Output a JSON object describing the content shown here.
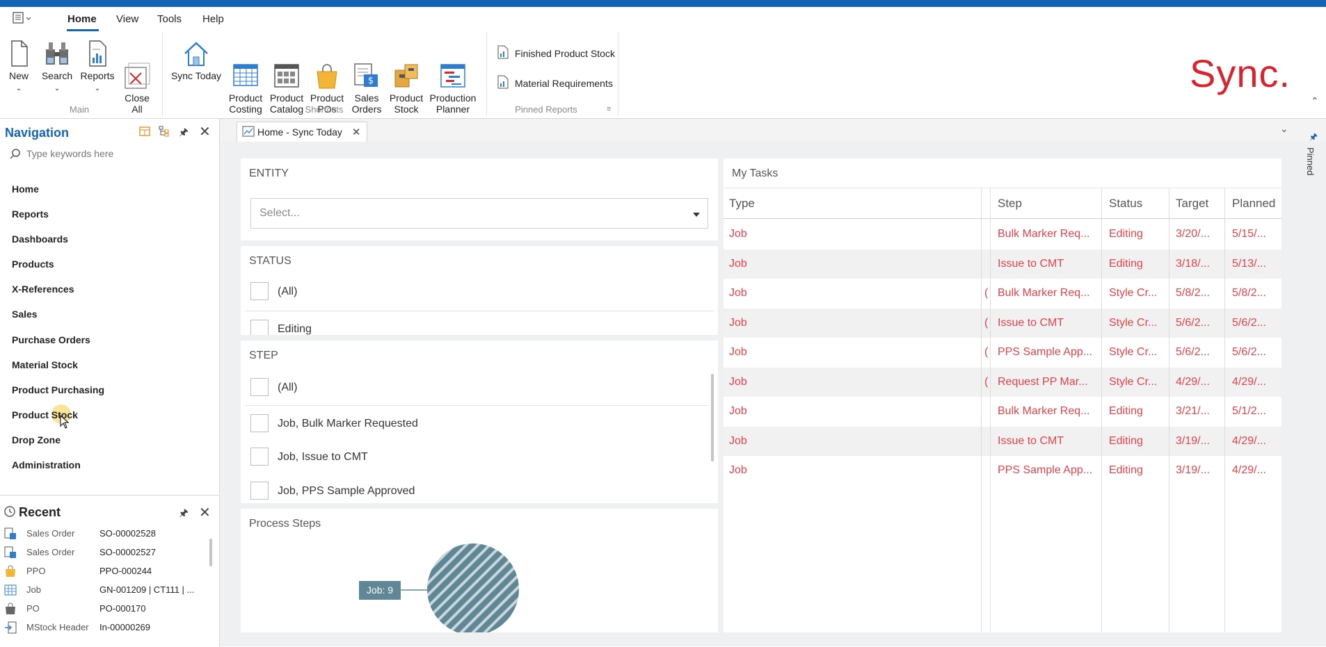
{
  "menu": {
    "items": [
      "Home",
      "View",
      "Tools",
      "Help"
    ],
    "active": "Home"
  },
  "ribbon": {
    "main_group": {
      "label": "Main",
      "buttons": [
        {
          "label": "New",
          "icon": "new-document-icon"
        },
        {
          "label": "Search",
          "icon": "binoculars-icon"
        },
        {
          "label": "Reports",
          "icon": "report-icon"
        },
        {
          "label": "Close\nAll",
          "icon": "close-all-icon"
        }
      ]
    },
    "shortcuts_group": {
      "label": "Shortcuts",
      "buttons": [
        {
          "label": "Sync Today",
          "icon": "home-icon"
        },
        {
          "label": "Product\nCosting",
          "icon": "costing-grid-icon"
        },
        {
          "label": "Product\nCatalog",
          "icon": "catalog-icon"
        },
        {
          "label": "Product\nPOs",
          "icon": "shopping-bag-icon"
        },
        {
          "label": "Sales\nOrders",
          "icon": "sales-orders-icon"
        },
        {
          "label": "Product\nStock",
          "icon": "boxes-icon"
        },
        {
          "label": "Production\nPlanner",
          "icon": "planner-icon"
        }
      ]
    },
    "pinned_group": {
      "label": "Pinned Reports",
      "items": [
        "Finished Product Stock",
        "Material Requirements"
      ]
    },
    "logo_text": "Sync."
  },
  "navigation": {
    "title": "Navigation",
    "search_placeholder": "Type keywords here",
    "items": [
      "Home",
      "Reports",
      "Dashboards",
      "Products",
      "X-References",
      "Sales",
      "Purchase Orders",
      "Material Stock",
      "Product Purchasing",
      "Product Stock",
      "Drop Zone",
      "Administration"
    ]
  },
  "recent": {
    "title": "Recent",
    "rows": [
      {
        "type": "Sales Order",
        "value": "SO-00002528",
        "icon": "sales-order-icon"
      },
      {
        "type": "Sales Order",
        "value": "SO-00002527",
        "icon": "sales-order-icon"
      },
      {
        "type": "PPO",
        "value": "PPO-000244",
        "icon": "shopping-bag-icon"
      },
      {
        "type": "Job",
        "value": "GN-001209 | CT111 | ...",
        "icon": "job-grid-icon"
      },
      {
        "type": "PO",
        "value": "PO-000170",
        "icon": "bag-icon"
      },
      {
        "type": "MStock Header",
        "value": "In-00000269",
        "icon": "stock-in-icon"
      }
    ]
  },
  "document_tab": {
    "label": "Home - Sync Today"
  },
  "entity": {
    "title": "ENTITY",
    "select_placeholder": "Select..."
  },
  "status": {
    "title": "STATUS",
    "options": [
      "(All)",
      "Editing"
    ]
  },
  "step": {
    "title": "STEP",
    "options": [
      "(All)",
      "Job, Bulk Marker Requested",
      "Job, Issue to CMT",
      "Job, PPS Sample Approved"
    ]
  },
  "process_steps": {
    "title": "Process Steps",
    "callout": "Job: 9",
    "colors": {
      "pie": "#5f8796",
      "callout": "#5f8796"
    }
  },
  "tasks": {
    "title": "My Tasks",
    "columns": [
      "Type",
      "",
      "Step",
      "Status",
      "Target",
      "Planned"
    ],
    "rows": [
      {
        "type": "Job",
        "mid": "",
        "step": "Bulk Marker Req...",
        "status": "Editing",
        "target": "3/20/...",
        "planned": "5/15/..."
      },
      {
        "type": "Job",
        "mid": "",
        "step": "Issue to CMT",
        "status": "Editing",
        "target": "3/18/...",
        "planned": "5/13/..."
      },
      {
        "type": "Job",
        "mid": "(",
        "step": "Bulk Marker Req...",
        "status": "Style Cr...",
        "target": "5/8/2...",
        "planned": "5/8/2..."
      },
      {
        "type": "Job",
        "mid": "(",
        "step": "Issue to CMT",
        "status": "Style Cr...",
        "target": "5/6/2...",
        "planned": "5/6/2..."
      },
      {
        "type": "Job",
        "mid": "(",
        "step": "PPS Sample App...",
        "status": "Style Cr...",
        "target": "5/6/2...",
        "planned": "5/6/2..."
      },
      {
        "type": "Job",
        "mid": "(",
        "step": "Request PP Mar...",
        "status": "Style Cr...",
        "target": "4/29/...",
        "planned": "4/29/..."
      },
      {
        "type": "Job",
        "mid": "",
        "step": "Bulk Marker Req...",
        "status": "Editing",
        "target": "3/21/...",
        "planned": "5/1/2..."
      },
      {
        "type": "Job",
        "mid": "",
        "step": "Issue to CMT",
        "status": "Editing",
        "target": "3/19/...",
        "planned": "4/29/..."
      },
      {
        "type": "Job",
        "mid": "",
        "step": "PPS Sample App...",
        "status": "Editing",
        "target": "3/19/...",
        "planned": "4/29/..."
      }
    ]
  },
  "right_rail": {
    "label": "Pinned"
  },
  "colors": {
    "accent": "#1464b4",
    "task_text": "#e0434c",
    "logo": "#d8242e"
  }
}
